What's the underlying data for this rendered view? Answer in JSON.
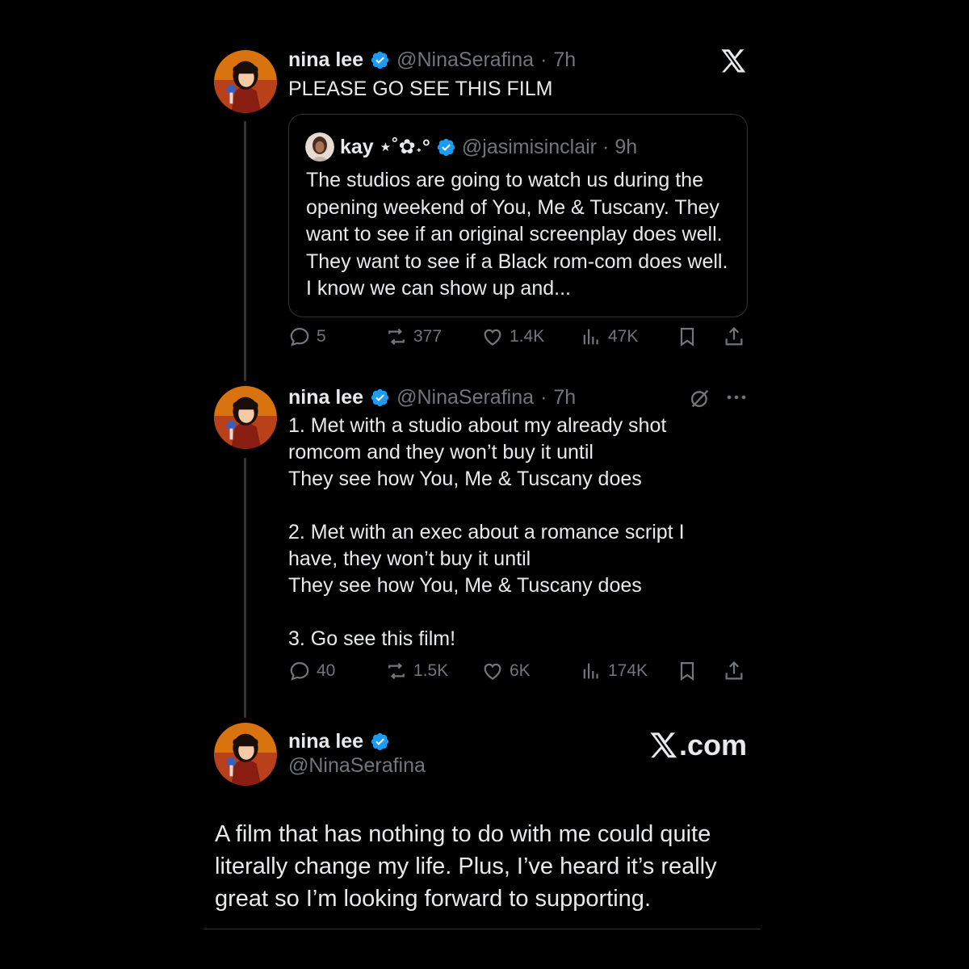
{
  "brand": {
    "x_color": "#e7e9ea",
    "verified_color": "#1d9bf0",
    "muted_color": "#71767b",
    "xcom_label": ".com"
  },
  "tweet1": {
    "author_name": "nina lee",
    "author_handle": "@NinaSerafina",
    "separator": "·",
    "time": "7h",
    "text": "PLEASE GO SEE THIS FILM",
    "avatar_icon": "cartoon-avatar-icon",
    "quote": {
      "author_name": "kay ⋆˚✿˖°",
      "author_handle": "@jasimisinclair",
      "separator": "·",
      "time": "9h",
      "text": "The studios are going to watch us during the opening weekend of You, Me & Tuscany. They want to see if an original screenplay does well. They want to see if a Black rom-com does well. I know we can show up and..."
    },
    "stats": {
      "replies": "5",
      "reposts": "377",
      "likes": "1.4K",
      "views": "47K"
    }
  },
  "tweet2": {
    "author_name": "nina lee",
    "author_handle": "@NinaSerafina",
    "separator": "·",
    "time": "7h",
    "text": "1. Met with a studio about my already shot\nromcom and they won’t buy it until\nThey see how You, Me & Tuscany does\n\n2. Met with an exec about a romance script I\nhave, they won’t buy it until\nThey see how You, Me & Tuscany does\n\n3. Go see this film!",
    "stats": {
      "replies": "40",
      "reposts": "1.5K",
      "likes": "6K",
      "views": "174K"
    }
  },
  "tweet3": {
    "author_name": "nina lee",
    "author_handle": "@NinaSerafina",
    "text": "A film that has nothing to do with me could quite literally change my life. Plus, I’ve heard it’s really great so I’m looking forward to supporting."
  }
}
